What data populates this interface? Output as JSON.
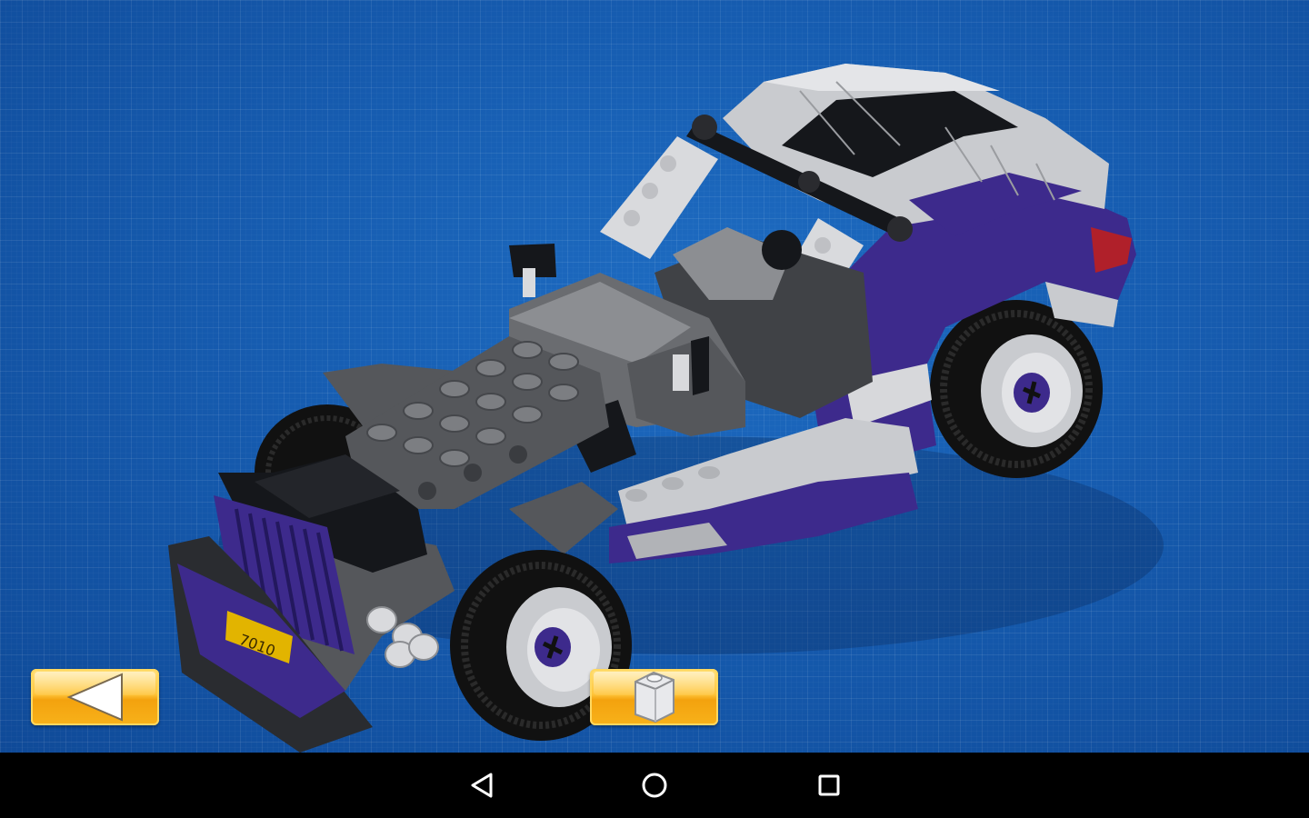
{
  "app": {
    "screen": "building-instructions-model-view",
    "background_color": "#165cb0",
    "grid_color": "#3a7fd0"
  },
  "model": {
    "license_plate_text": "7010",
    "body_colors": {
      "purple": "#3d2a8c",
      "light_gray": "#c9cbcf",
      "dark_gray": "#55575b",
      "black": "#15171b",
      "rubber": "#111111",
      "red": "#b0202a"
    }
  },
  "controls": {
    "back_button_icon": "triangle-left-icon",
    "brick_button_icon": "brick-icon",
    "button_color": "#f8b21a"
  },
  "navbar": {
    "back_icon": "nav-back-icon",
    "home_icon": "nav-home-icon",
    "recents_icon": "nav-recents-icon"
  }
}
